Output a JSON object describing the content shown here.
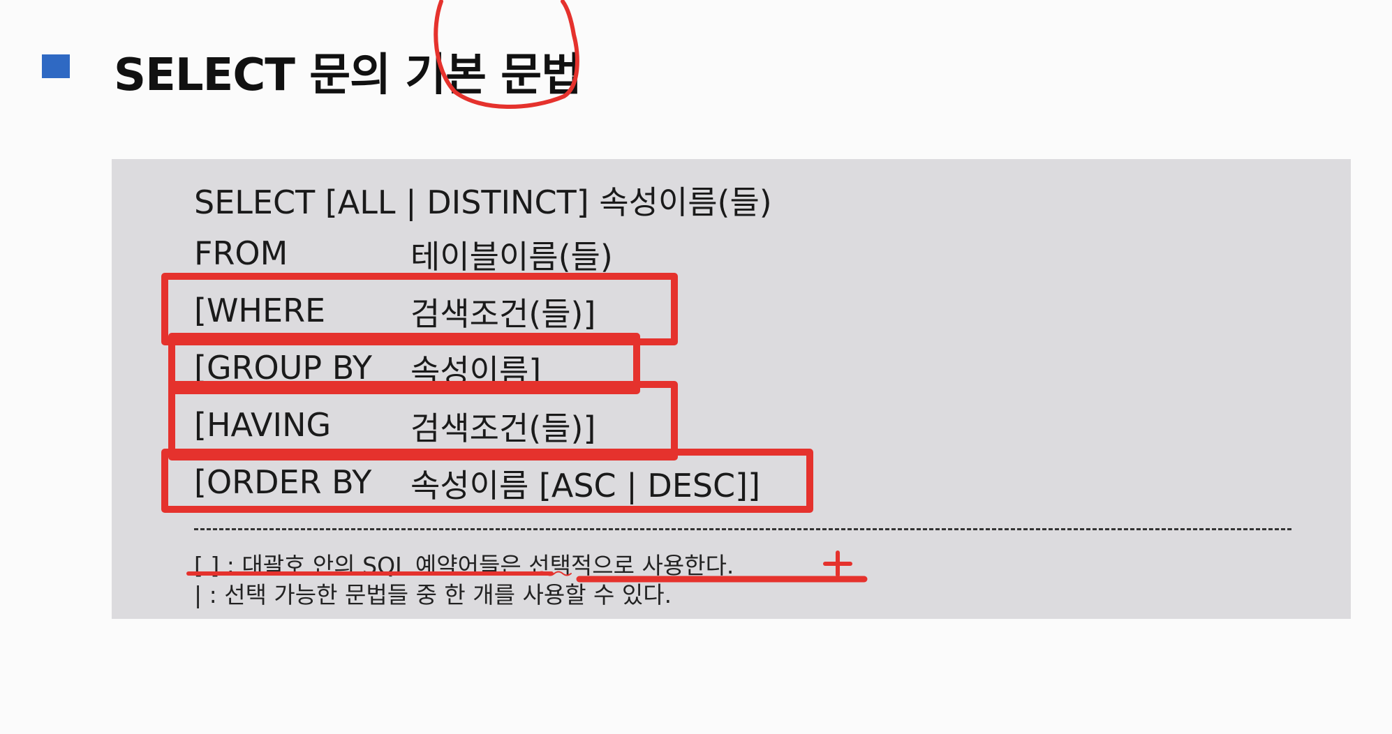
{
  "heading": {
    "title": "SELECT 문의 기본 문법"
  },
  "syntax": {
    "select_line": "SELECT [ALL | DISTINCT] 속성이름(들)",
    "from_kw": "FROM",
    "from_arg": "테이블이름(들)",
    "where_kw": "[WHERE",
    "where_arg": "검색조건(들)]",
    "group_kw": "[GROUP BY",
    "group_arg": "속성이름]",
    "having_kw": "[HAVING",
    "having_arg": "검색조건(들)]",
    "order_kw": "[ORDER BY",
    "order_arg": "속성이름 [ASC | DESC]]"
  },
  "notes": {
    "line1": "[ ] : 대괄호 안의 SQL 예약어들은 선택적으로 사용한다.",
    "line2": "| : 선택 가능한 문법들 중 한 개를 사용할 수 있다."
  },
  "colors": {
    "accent": "#2f69c3",
    "box_bg": "#dcdbde",
    "annotation_red": "#e5322d"
  }
}
